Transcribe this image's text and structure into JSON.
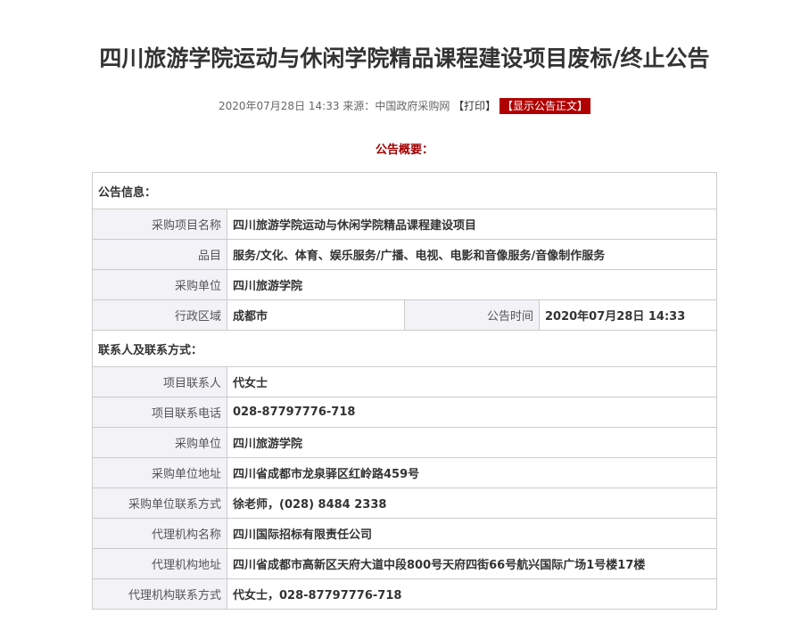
{
  "title": "四川旅游学院运动与休闲学院精品课程建设项目废标/终止公告",
  "meta": {
    "datetime": "2020年07月28日 14:33",
    "source_label": "来源：",
    "source": "中国政府采购网",
    "print": "【打印】",
    "show_full": "【显示公告正文】"
  },
  "summary_heading": "公告概要：",
  "section_info": "公告信息：",
  "section_contact": "联系人及联系方式：",
  "info": {
    "project_name_label": "采购项目名称",
    "project_name": "四川旅游学院运动与休闲学院精品课程建设项目",
    "category_label": "品目",
    "category": "服务/文化、体育、娱乐服务/广播、电视、电影和音像服务/音像制作服务",
    "purchaser_label": "采购单位",
    "purchaser": "四川旅游学院",
    "region_label": "行政区域",
    "region": "成都市",
    "pub_time_label": "公告时间",
    "pub_time": "2020年07月28日 14:33"
  },
  "contact": {
    "project_contact_label": "项目联系人",
    "project_contact": "代女士",
    "project_phone_label": "项目联系电话",
    "project_phone": "028-87797776-718",
    "purchaser_label": "采购单位",
    "purchaser": "四川旅游学院",
    "purchaser_addr_label": "采购单位地址",
    "purchaser_addr": "四川省成都市龙泉驿区红岭路459号",
    "purchaser_contact_label": "采购单位联系方式",
    "purchaser_contact": "徐老师，(028) 8484 2338",
    "agency_name_label": "代理机构名称",
    "agency_name": "四川国际招标有限责任公司",
    "agency_addr_label": "代理机构地址",
    "agency_addr": "四川省成都市高新区天府大道中段800号天府四街66号航兴国际广场1号楼17楼",
    "agency_contact_label": "代理机构联系方式",
    "agency_contact": "代女士，028-87797776-718"
  }
}
